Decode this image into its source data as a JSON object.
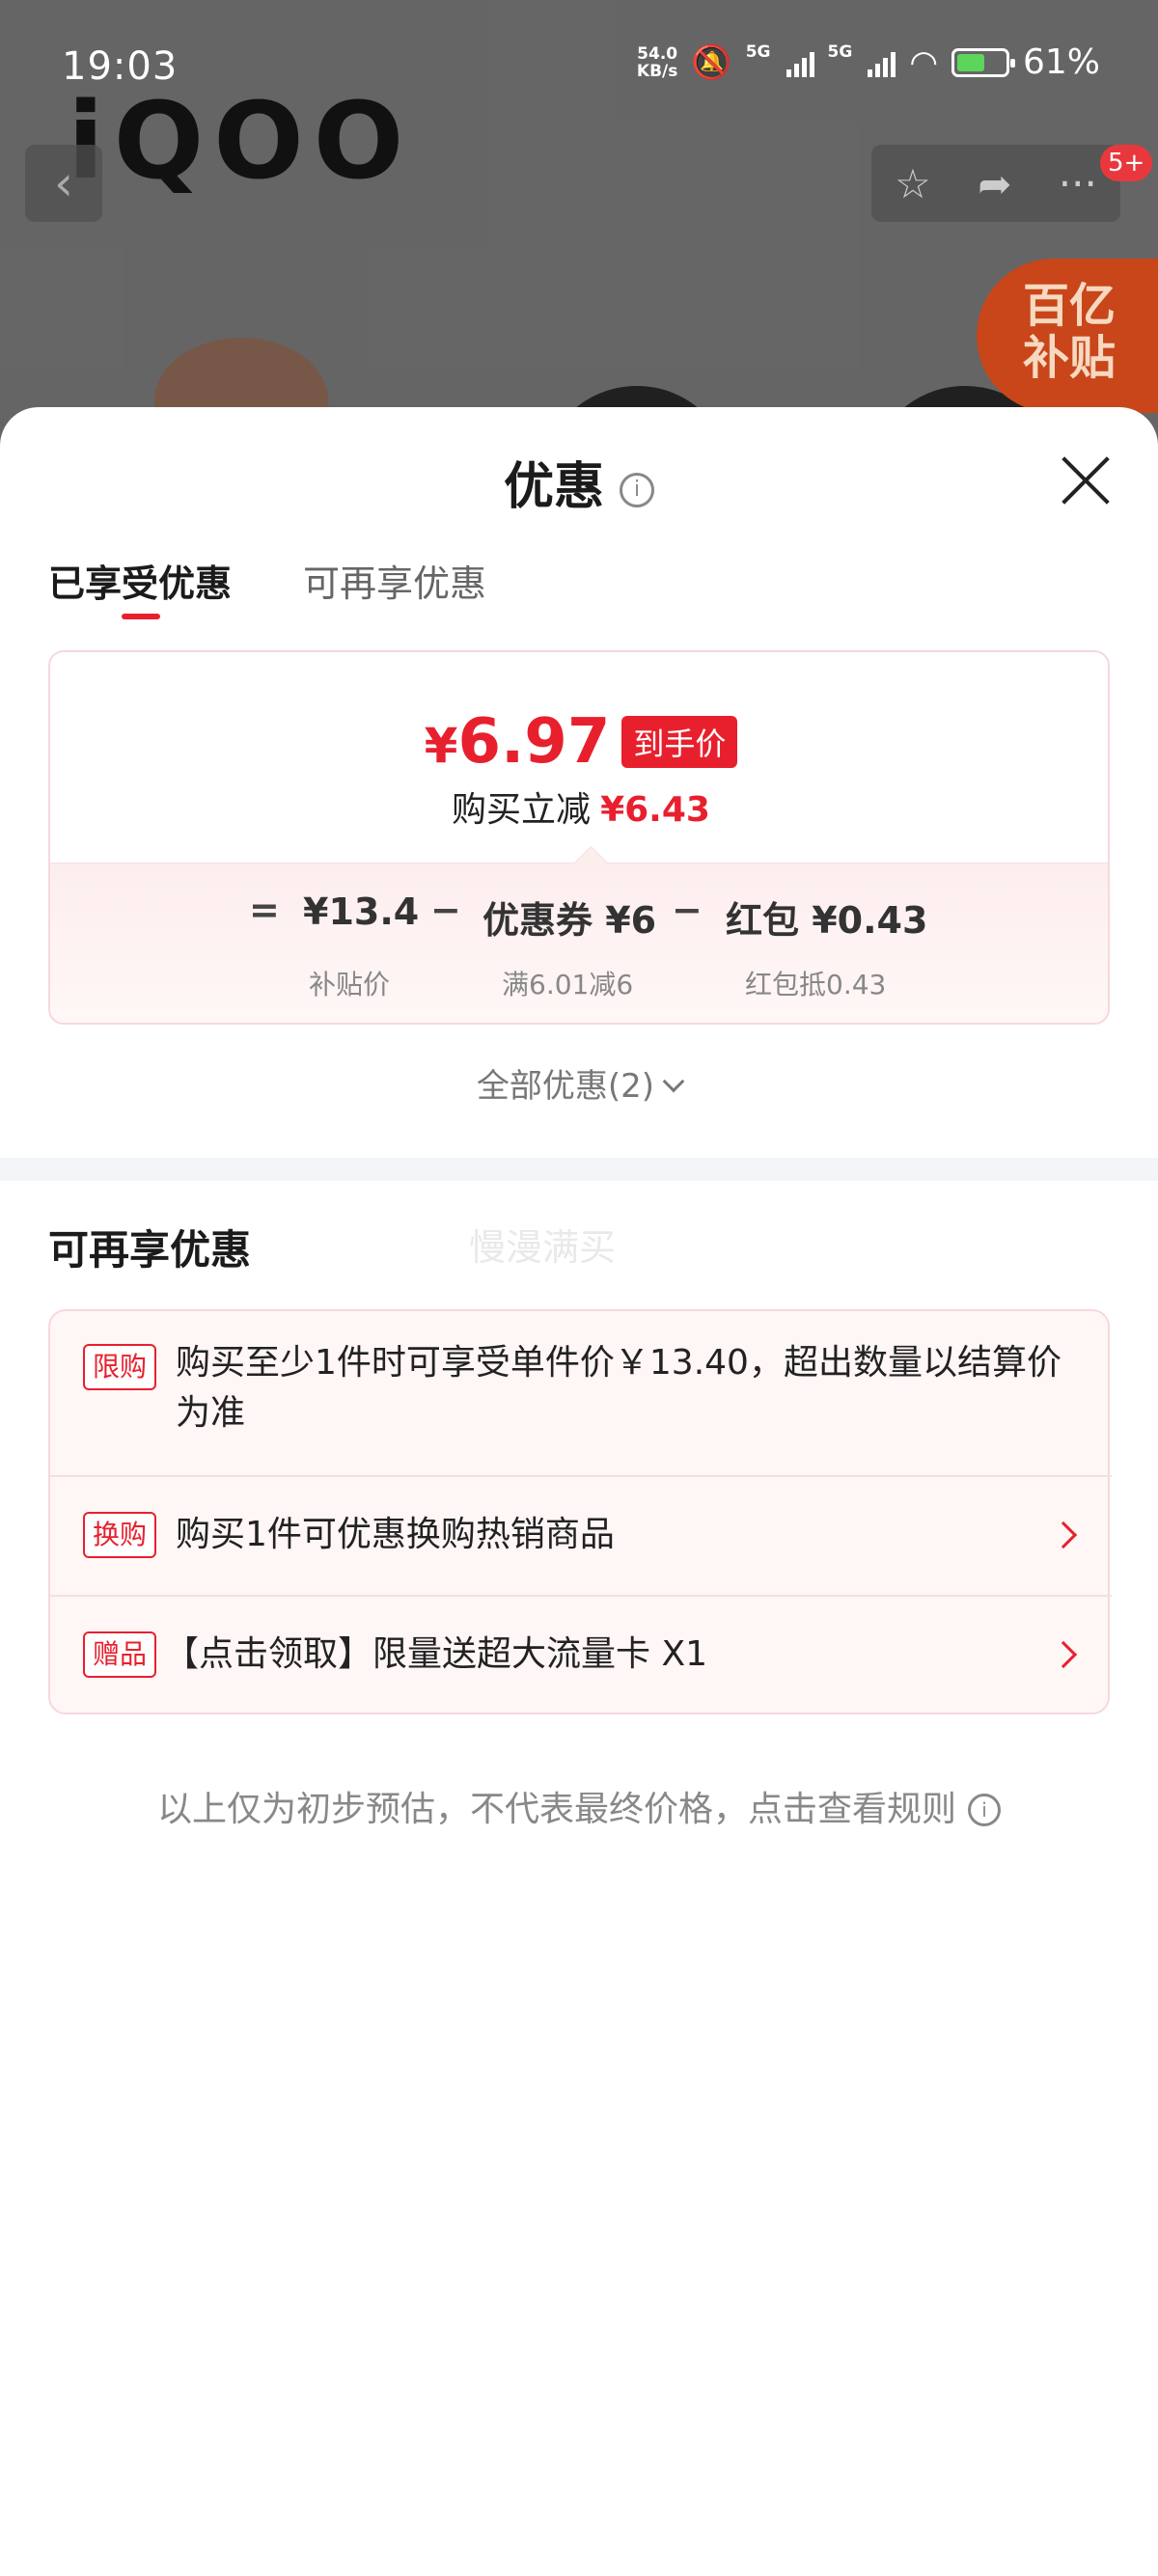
{
  "status_bar": {
    "time": "19:03",
    "net_speed_value": "54.0",
    "net_speed_unit": "KB/s",
    "signal_1_label": "5G",
    "signal_2_label": "5G",
    "battery_percent": "61%"
  },
  "background_page": {
    "brand_logo": "iQOO",
    "notif_badge": "5+",
    "subsidy_badge_line1": "百亿",
    "subsidy_badge_line2": "补贴",
    "icons": {
      "back": "chevron-left-icon",
      "favorite": "star-icon",
      "share": "share-icon",
      "more": "more-icon"
    }
  },
  "sheet": {
    "title": "优惠",
    "tabs": [
      {
        "label": "已享受优惠",
        "active": true
      },
      {
        "label": "可再享优惠",
        "active": false
      }
    ],
    "price_card": {
      "final_price_currency": "¥",
      "final_price_value": "6.97",
      "final_price_tag": "到手价",
      "reduce_label": "购买立减",
      "reduce_amount": "¥6.43",
      "breakdown": {
        "equals": "=",
        "subsidy_price": "¥13.4",
        "subsidy_label": "补贴价",
        "minus_1": "−",
        "coupon": "优惠券 ¥6",
        "coupon_label": "满6.01减6",
        "minus_2": "−",
        "red_packet": "红包 ¥0.43",
        "red_packet_label": "红包抵0.43"
      }
    },
    "all_discounts_label": "全部优惠(2)",
    "more_section_title": "可再享优惠",
    "watermark": "慢漫满买",
    "promos": [
      {
        "tag": "限购",
        "text": "购买至少1件时可享受单件价￥13.40，超出数量以结算价为准",
        "has_arrow": false
      },
      {
        "tag": "换购",
        "text": "购买1件可优惠换购热销商品",
        "has_arrow": true
      },
      {
        "tag": "赠品",
        "text": "【点击领取】限量送超大流量卡 X1",
        "has_arrow": true
      }
    ],
    "footnote": "以上仅为初步预估，不代表最终价格，点击查看规则",
    "colors": {
      "accent": "#e8202e",
      "card_border": "#f6d8dc",
      "card_bg": "#fff6f6"
    }
  }
}
